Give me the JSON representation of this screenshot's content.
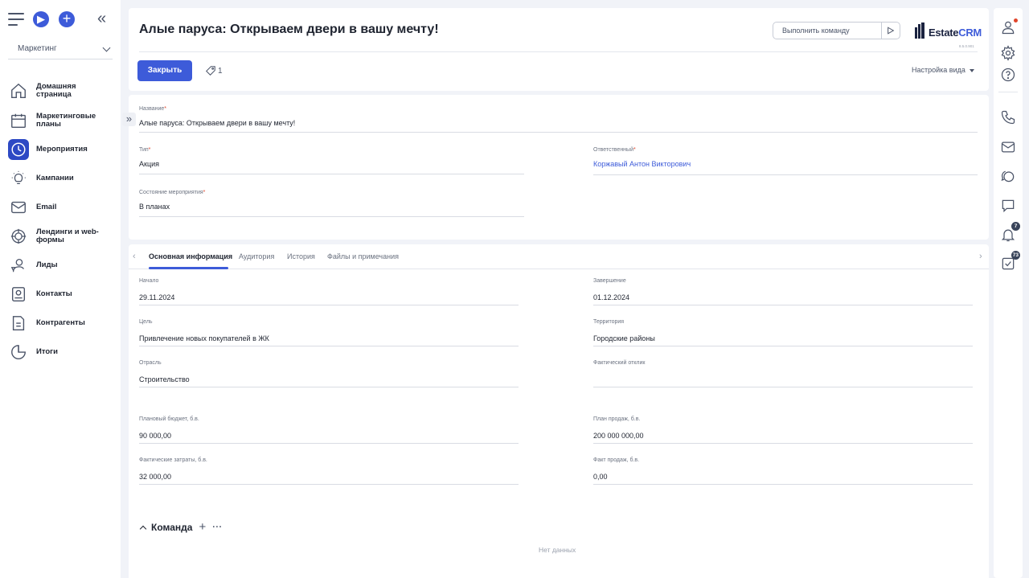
{
  "sidebar": {
    "section_select": "Маркетинг",
    "items": [
      {
        "label": "Домашняя страница",
        "icon": "home-icon"
      },
      {
        "label": "Маркетинговые планы",
        "icon": "calendar-icon"
      },
      {
        "label": "Мероприятия",
        "icon": "clock-icon",
        "active": true
      },
      {
        "label": "Кампании",
        "icon": "lightbulb-icon"
      },
      {
        "label": "Email",
        "icon": "mail-icon"
      },
      {
        "label": "Лендинги и web-формы",
        "icon": "target-icon"
      },
      {
        "label": "Лиды",
        "icon": "lead-user-icon"
      },
      {
        "label": "Контакты",
        "icon": "contact-card-icon"
      },
      {
        "label": "Контрагенты",
        "icon": "document-icon"
      },
      {
        "label": "Итоги",
        "icon": "pie-chart-icon"
      }
    ]
  },
  "header": {
    "title": "Алые паруса: Открываем двери в вашу мечту!",
    "command_placeholder": "Выполнить команду",
    "logo_text_dark": "Estate",
    "logo_text_accent": "CRM",
    "version": "8.5.0.901",
    "close_button": "Закрыть",
    "tag_count": "1",
    "view_settings": "Настройка вида"
  },
  "form": {
    "name": {
      "label": "Название",
      "value": "Алые паруса: Открываем двери в вашу мечту!"
    },
    "type": {
      "label": "Тип",
      "value": "Акция"
    },
    "responsible": {
      "label": "Ответственный",
      "value": "Коржавый Антон Викторович"
    },
    "state": {
      "label": "Состояние мероприятия",
      "value": "В планах"
    }
  },
  "tabs": [
    "Основная информация",
    "Аудитория",
    "История",
    "Файлы и примечания"
  ],
  "details": {
    "start": {
      "label": "Начало",
      "value": "29.11.2024"
    },
    "end": {
      "label": "Завершение",
      "value": "01.12.2024"
    },
    "goal": {
      "label": "Цель",
      "value": "Привлечение новых покупателей в ЖК"
    },
    "territory": {
      "label": "Территория",
      "value": "Городские районы"
    },
    "industry": {
      "label": "Отрасль",
      "value": "Строительство"
    },
    "actual_response": {
      "label": "Фактический отклик",
      "value": ""
    },
    "planned_budget": {
      "label": "Плановый бюджет, б.в.",
      "value": "90 000,00"
    },
    "sales_plan": {
      "label": "План продаж, б.в.",
      "value": "200 000 000,00"
    },
    "actual_costs": {
      "label": "Фактические затраты, б.в.",
      "value": "32 000,00"
    },
    "actual_sales": {
      "label": "Факт продаж, б.в.",
      "value": "0,00"
    }
  },
  "team": {
    "title": "Команда",
    "empty": "Нет данных"
  },
  "rail": {
    "notifications_badge": "7",
    "tasks_badge": "73"
  },
  "colors": {
    "accent": "#3d5bd9",
    "active_nav": "#2d49c4",
    "required": "#e0452b"
  }
}
